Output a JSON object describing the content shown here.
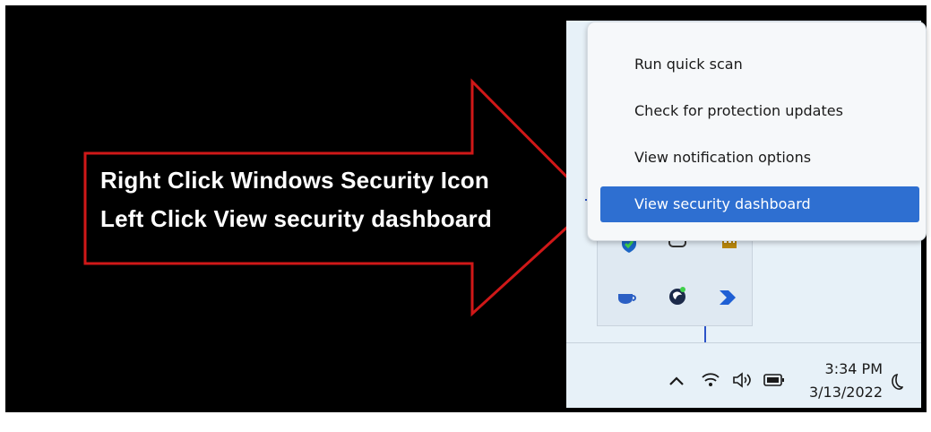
{
  "instructions": {
    "line1": "Right Click Windows Security Icon",
    "line2": "Left Click View security dashboard"
  },
  "context_menu": {
    "items": [
      {
        "label": "Run quick scan"
      },
      {
        "label": "Check for protection updates"
      },
      {
        "label": "View notification options"
      },
      {
        "label": "View security dashboard",
        "selected": true
      }
    ]
  },
  "tray_overflow": {
    "icons": [
      "windows-security-icon",
      "onedrive-icon",
      "keyboard-icon",
      "teams-chat-icon",
      "copilot-icon",
      "power-automate-icon"
    ]
  },
  "taskbar": {
    "icons": [
      "chevron-up-icon",
      "wifi-icon",
      "speaker-icon",
      "battery-icon",
      "moon-icon"
    ],
    "time": "3:34 PM",
    "date": "3/13/2022"
  },
  "colors": {
    "arrow_outline": "#d01818",
    "menu_selected": "#2e6fd1",
    "taskbar_bg": "#e7f1f8"
  }
}
